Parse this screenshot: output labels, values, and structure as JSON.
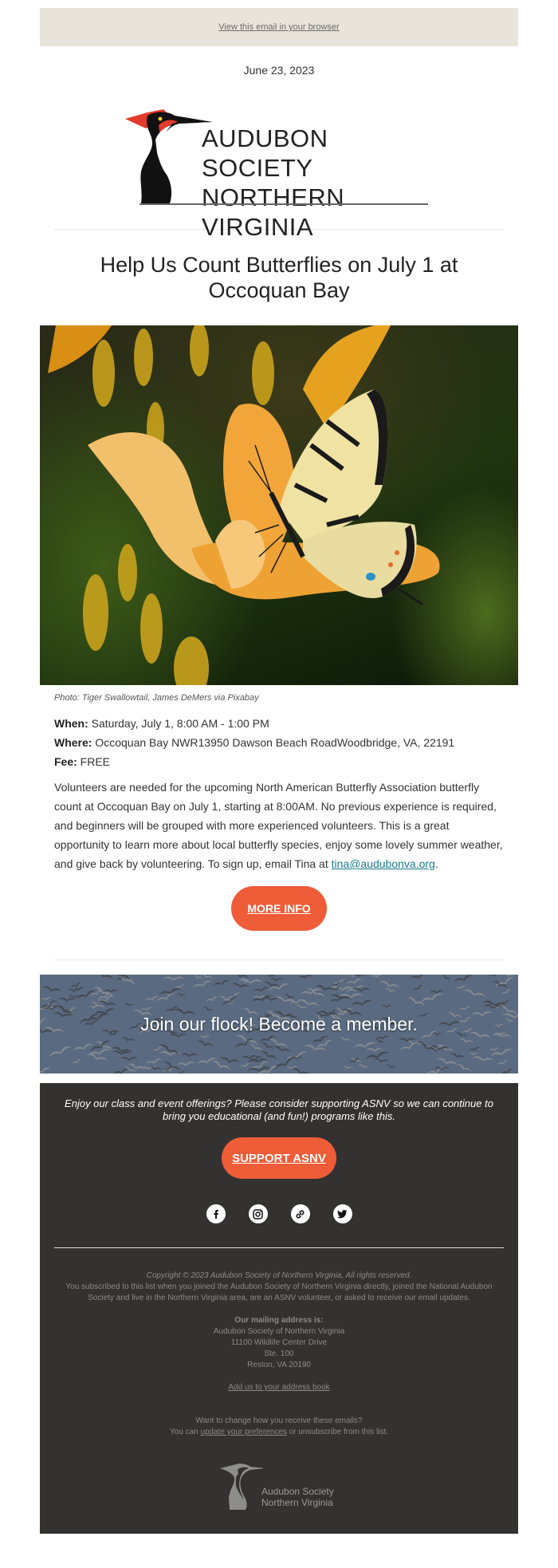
{
  "preheader": {
    "view_in_browser": "View this email in your browser"
  },
  "date": "June 23, 2023",
  "logo": {
    "line1": "AUDUBON SOCIETY",
    "line2": "NORTHERN VIRGINIA",
    "accent_red": "#e23a2c"
  },
  "article": {
    "title": "Help Us Count Butterflies on July 1 at Occoquan Bay",
    "photo_alt": "Tiger Swallowtail butterfly on an orange daylily",
    "caption": "Photo: Tiger Swallowtail, James DeMers via Pixabay",
    "when_label": "When:",
    "when_value": " Saturday, July 1, 8:00 AM - 1:00 PM",
    "where_label": "Where:",
    "where_value": " Occoquan Bay NWR13950 Dawson Beach RoadWoodbridge, VA, 22191",
    "fee_label": "Fee:",
    "fee_value": " FREE",
    "body": "Volunteers are needed for the upcoming North American Butterfly Association butterfly count at Occoquan Bay on July 1, starting at 8:00AM. No previous experience is required, and beginners will be grouped with more experienced volunteers. This is a great opportunity to learn more about local butterfly species, enjoy some lovely summer weather, and give back by volunteering. To sign up, email Tina at ",
    "email_link": "tina@audubonva.org",
    "body_end": ".",
    "cta": "MORE INFO",
    "cta_color": "#ee5c38"
  },
  "membership_banner": {
    "text": "Join our flock! Become a member."
  },
  "footer": {
    "pitch": "Enjoy our class and event offerings? Please consider supporting ASNV so we can continue to bring you educational (and fun!) programs like this.",
    "support_button": "SUPPORT ASNV",
    "social": [
      {
        "name": "facebook-icon",
        "label": "Facebook"
      },
      {
        "name": "instagram-icon",
        "label": "Instagram"
      },
      {
        "name": "link-icon",
        "label": "Website"
      },
      {
        "name": "twitter-icon",
        "label": "Twitter"
      }
    ],
    "copyright": "Copyright © 2023 Audubon Society of Northern Virginia, All rights reserved.",
    "subscribed_note": "You subscribed to this list when you joined the Audubon Society of Northern Virginia directly, joined the National Audubon Society and live in the Northern Virginia area, are an ASNV volunteer, or asked to receive our email updates.",
    "mailing_heading": "Our mailing address is:",
    "address": [
      "Audubon Society of Northern Virginia",
      "11100 Wildlife Center Drive",
      "Ste. 100",
      "Reston, VA 20190"
    ],
    "address_book_link": "Add us to your address book",
    "prefs_question": "Want to change how you receive these emails?",
    "prefs_prefix": "You can ",
    "prefs_link": "update your preferences",
    "prefs_suffix": " or unsubscribe from this list.",
    "logo_line1": "Audubon Society",
    "logo_line2": "Northern Virginia",
    "background": "#333230"
  }
}
